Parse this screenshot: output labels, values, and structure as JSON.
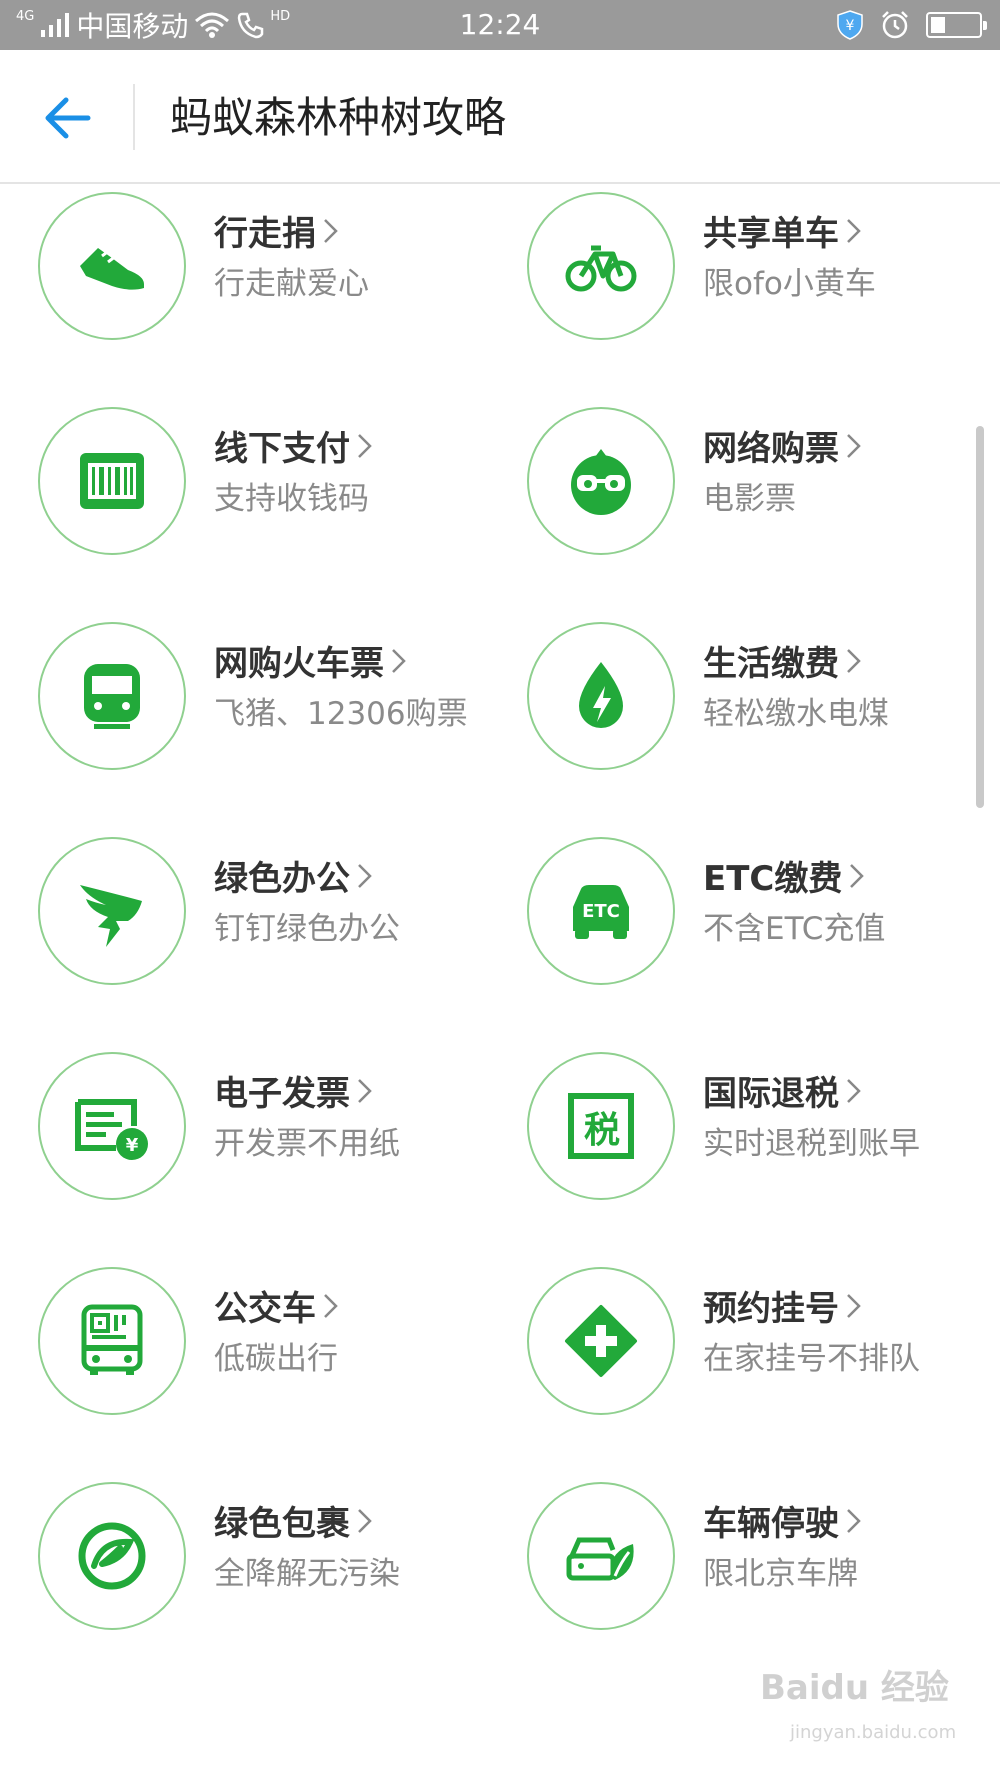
{
  "status_bar": {
    "network": "4G",
    "carrier": "中国移动",
    "call_badge": "HD",
    "time": "12:24"
  },
  "header": {
    "title": "蚂蚁森林种树攻略",
    "back_icon": "arrow-left-icon"
  },
  "colors": {
    "accent": "#22a93a",
    "ring": "#8fd08f",
    "back": "#1a8fe6"
  },
  "items": [
    {
      "title": "行走捐",
      "subtitle": "行走献爱心",
      "icon": "shoe-icon"
    },
    {
      "title": "共享单车",
      "subtitle": "限ofo小黄车",
      "icon": "bicycle-icon"
    },
    {
      "title": "线下支付",
      "subtitle": "支持收钱码",
      "icon": "barcode-icon"
    },
    {
      "title": "网络购票",
      "subtitle": "电影票",
      "icon": "movie-mascot-icon"
    },
    {
      "title": "网购火车票",
      "subtitle": "飞猪、12306购票",
      "icon": "train-icon"
    },
    {
      "title": "生活缴费",
      "subtitle": "轻松缴水电煤",
      "icon": "water-power-icon"
    },
    {
      "title": "绿色办公",
      "subtitle": "钉钉绿色办公",
      "icon": "dingtalk-icon"
    },
    {
      "title": "ETC缴费",
      "subtitle": "不含ETC充值",
      "icon": "etc-car-icon",
      "icon_text": "ETC"
    },
    {
      "title": "电子发票",
      "subtitle": "开发票不用纸",
      "icon": "e-invoice-icon",
      "icon_text": "¥"
    },
    {
      "title": "国际退税",
      "subtitle": "实时退税到账早",
      "icon": "tax-refund-icon",
      "icon_text": "税"
    },
    {
      "title": "公交车",
      "subtitle": "低碳出行",
      "icon": "bus-qr-icon"
    },
    {
      "title": "预约挂号",
      "subtitle": "在家挂号不排队",
      "icon": "medical-cross-icon"
    },
    {
      "title": "绿色包裹",
      "subtitle": "全降解无污染",
      "icon": "green-package-icon"
    },
    {
      "title": "车辆停驶",
      "subtitle": "限北京车牌",
      "icon": "car-leaf-icon"
    }
  ],
  "watermark": {
    "text": "Baidu 经验",
    "sub": "jingyan.baidu.com"
  }
}
